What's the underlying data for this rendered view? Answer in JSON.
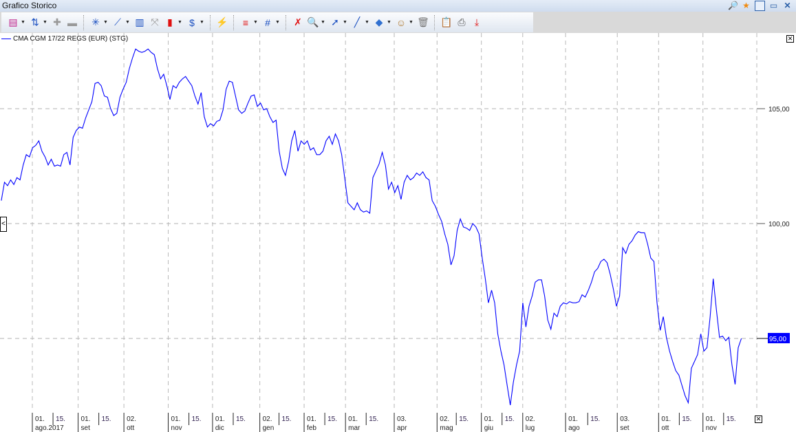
{
  "window": {
    "title": "Grafico Storico"
  },
  "toolbar": {
    "buttons": [
      {
        "icon": "chart-type-icon",
        "dropdown": true,
        "glyph": "▤",
        "color": "#c0208a"
      },
      {
        "icon": "indicators-icon",
        "dropdown": true,
        "glyph": "⇅",
        "color": "#1a4fc0"
      },
      {
        "icon": "add-series-icon",
        "dropdown": false,
        "glyph": "✚",
        "color": "#999999"
      },
      {
        "icon": "remove-series-icon",
        "dropdown": false,
        "glyph": "▬",
        "color": "#999999"
      },
      {
        "sep": true
      },
      {
        "icon": "new-study-icon",
        "dropdown": true,
        "glyph": "✳",
        "color": "#1a4fc0"
      },
      {
        "icon": "trend-icon",
        "dropdown": true,
        "glyph": "⟋",
        "color": "#1a4fc0"
      },
      {
        "icon": "volume-bars-icon",
        "dropdown": false,
        "glyph": "▥",
        "color": "#1a4fc0"
      },
      {
        "icon": "compare-icon",
        "dropdown": false,
        "glyph": "⤧",
        "color": "#999999"
      },
      {
        "icon": "candlestick-icon",
        "dropdown": true,
        "glyph": "▮",
        "color": "#e01010"
      },
      {
        "icon": "currency-icon",
        "dropdown": true,
        "glyph": "$",
        "color": "#1a4fc0"
      },
      {
        "sep": true
      },
      {
        "icon": "refresh-chart-icon",
        "dropdown": false,
        "glyph": "⚡",
        "color": "#1a4fc0"
      },
      {
        "sep": true
      },
      {
        "icon": "line-style-icon",
        "dropdown": true,
        "glyph": "≡",
        "color": "#e01010"
      },
      {
        "icon": "grid-icon",
        "dropdown": true,
        "glyph": "#",
        "color": "#1a4fc0"
      },
      {
        "sep": true
      },
      {
        "icon": "delete-drawings-icon",
        "dropdown": false,
        "glyph": "✗",
        "color": "#e01010"
      },
      {
        "icon": "zoom-icon",
        "dropdown": true,
        "glyph": "🔍",
        "color": "#1a4fc0"
      },
      {
        "icon": "pointer-icon",
        "dropdown": true,
        "glyph": "➚",
        "color": "#1a4fc0"
      },
      {
        "icon": "draw-line-icon",
        "dropdown": true,
        "glyph": "╱",
        "color": "#1a4fc0"
      },
      {
        "icon": "fill-color-icon",
        "dropdown": true,
        "glyph": "◆",
        "color": "#3070d0"
      },
      {
        "icon": "template-icon",
        "dropdown": true,
        "glyph": "☺",
        "color": "#b07a30"
      },
      {
        "icon": "trash-icon",
        "dropdown": false,
        "glyph": "🗑",
        "color": "#777777"
      },
      {
        "sep": true
      },
      {
        "icon": "clipboard-icon",
        "dropdown": false,
        "glyph": "📋",
        "color": "#e01010"
      },
      {
        "icon": "print-icon",
        "dropdown": false,
        "glyph": "⎙",
        "color": "#555555"
      },
      {
        "icon": "export-icon",
        "dropdown": false,
        "glyph": "⤓",
        "color": "#e01010"
      }
    ]
  },
  "window_icons": [
    "search-folder-icon",
    "favorite-star-icon",
    "maximize-icon",
    "restore-icon",
    "close-icon"
  ],
  "legend": {
    "label": "CMA CGM 17/22 REGS (EUR) (STG)",
    "color": "#0000ff"
  },
  "chart_data": {
    "type": "line",
    "title": "CMA CGM 17/22 REGS (EUR) (STG)",
    "xlabel": "",
    "ylabel": "",
    "ylim": [
      91.9,
      108.4
    ],
    "y_ticks": [
      {
        "value": 105,
        "label": "105,00"
      },
      {
        "value": 100,
        "label": "100,00"
      }
    ],
    "last_value_label": {
      "value": 95,
      "label": "95,00",
      "bg": "#0000ff"
    },
    "x_origin_date": "2017-08-01",
    "x_range_days": [
      -21,
      480
    ],
    "x_ticks": [
      {
        "day": 0,
        "day_label": "01.",
        "month_label": "ago.2017",
        "major": true
      },
      {
        "day": 14,
        "day_label": "15.",
        "month_label": "",
        "major": false
      },
      {
        "day": 31,
        "day_label": "01.",
        "month_label": "set",
        "major": true
      },
      {
        "day": 45,
        "day_label": "15.",
        "month_label": "",
        "major": false
      },
      {
        "day": 62,
        "day_label": "02.",
        "month_label": "ott",
        "major": true
      },
      {
        "day": 92,
        "day_label": "01.",
        "month_label": "nov",
        "major": true
      },
      {
        "day": 106,
        "day_label": "15.",
        "month_label": "",
        "major": false
      },
      {
        "day": 122,
        "day_label": "01.",
        "month_label": "dic",
        "major": true
      },
      {
        "day": 136,
        "day_label": "15.",
        "month_label": "",
        "major": false
      },
      {
        "day": 154,
        "day_label": "02.",
        "month_label": "gen",
        "major": true
      },
      {
        "day": 167,
        "day_label": "15.",
        "month_label": "",
        "major": false
      },
      {
        "day": 184,
        "day_label": "01.",
        "month_label": "feb",
        "major": true
      },
      {
        "day": 198,
        "day_label": "15.",
        "month_label": "",
        "major": false
      },
      {
        "day": 212,
        "day_label": "01.",
        "month_label": "mar",
        "major": true
      },
      {
        "day": 226,
        "day_label": "15.",
        "month_label": "",
        "major": false
      },
      {
        "day": 245,
        "day_label": "03.",
        "month_label": "apr",
        "major": true
      },
      {
        "day": 274,
        "day_label": "02.",
        "month_label": "mag",
        "major": true
      },
      {
        "day": 287,
        "day_label": "15.",
        "month_label": "",
        "major": false
      },
      {
        "day": 304,
        "day_label": "01.",
        "month_label": "giu",
        "major": true
      },
      {
        "day": 318,
        "day_label": "15.",
        "month_label": "",
        "major": false
      },
      {
        "day": 332,
        "day_label": "02.",
        "month_label": "lug",
        "major": true
      },
      {
        "day": 361,
        "day_label": "01.",
        "month_label": "ago",
        "major": true
      },
      {
        "day": 376,
        "day_label": "15.",
        "month_label": "",
        "major": false
      },
      {
        "day": 396,
        "day_label": "03.",
        "month_label": "set",
        "major": true
      },
      {
        "day": 424,
        "day_label": "01.",
        "month_label": "ott",
        "major": true
      },
      {
        "day": 438,
        "day_label": "15.",
        "month_label": "",
        "major": false
      },
      {
        "day": 454,
        "day_label": "01.",
        "month_label": "nov",
        "major": true
      },
      {
        "day": 468,
        "day_label": "15.",
        "month_label": "",
        "major": false
      }
    ],
    "series": [
      {
        "name": "CMA CGM 17/22 REGS (EUR) (STG)",
        "color": "#0000ff",
        "values": [
          101.0,
          101.8,
          101.65,
          101.9,
          101.7,
          102.0,
          101.9,
          102.55,
          103.0,
          102.9,
          103.3,
          103.4,
          103.6,
          103.15,
          102.9,
          102.55,
          102.8,
          102.5,
          102.55,
          102.5,
          103.0,
          103.1,
          102.55,
          103.75,
          104.05,
          104.2,
          104.15,
          104.6,
          104.95,
          105.3,
          106.1,
          106.15,
          106.0,
          105.55,
          105.5,
          105.0,
          104.7,
          104.8,
          105.5,
          105.85,
          106.15,
          106.75,
          107.2,
          107.6,
          107.5,
          107.45,
          107.5,
          107.6,
          107.45,
          107.35,
          106.75,
          106.3,
          106.5,
          106.0,
          105.4,
          106.0,
          105.9,
          106.15,
          106.3,
          106.4,
          106.2,
          106.0,
          105.55,
          105.2,
          105.7,
          104.65,
          104.2,
          104.35,
          104.25,
          104.45,
          104.5,
          104.95,
          105.85,
          106.2,
          106.15,
          105.55,
          104.95,
          104.8,
          104.9,
          105.25,
          105.55,
          105.6,
          105.1,
          105.25,
          104.95,
          105.0,
          104.65,
          104.4,
          104.5,
          103.15,
          102.4,
          102.1,
          102.7,
          103.6,
          104.05,
          103.15,
          103.6,
          103.45,
          103.6,
          103.2,
          103.3,
          103.0,
          103.0,
          103.15,
          103.6,
          103.8,
          103.45,
          103.9,
          103.6,
          103.0,
          101.95,
          100.9,
          100.75,
          100.6,
          100.9,
          100.6,
          100.5,
          100.55,
          100.45,
          102.0,
          102.3,
          102.6,
          103.1,
          102.55,
          101.5,
          101.8,
          101.35,
          101.65,
          101.05,
          101.8,
          102.1,
          101.9,
          102.0,
          102.2,
          102.1,
          102.25,
          102.0,
          101.9,
          101.0,
          100.75,
          100.4,
          100.1,
          99.55,
          99.1,
          98.2,
          98.6,
          99.7,
          100.2,
          99.85,
          99.8,
          99.7,
          100.0,
          99.85,
          99.55,
          98.5,
          97.6,
          96.55,
          97.1,
          96.55,
          95.2,
          94.45,
          93.85,
          92.95,
          92.1,
          93.1,
          93.85,
          94.45,
          96.55,
          95.5,
          96.4,
          96.85,
          97.45,
          97.55,
          97.55,
          96.85,
          95.8,
          95.4,
          96.1,
          95.95,
          96.4,
          96.55,
          96.5,
          96.6,
          96.55,
          96.55,
          96.6,
          96.9,
          96.8,
          97.1,
          97.45,
          97.9,
          98.05,
          98.35,
          98.45,
          98.3,
          97.8,
          97.15,
          96.4,
          96.85,
          98.95,
          98.7,
          99.1,
          99.25,
          99.5,
          99.65,
          99.6,
          99.6,
          99.1,
          98.5,
          98.35,
          96.55,
          95.35,
          95.95,
          95.05,
          94.45,
          94.0,
          93.6,
          93.4,
          92.95,
          92.5,
          92.2,
          93.7,
          94.0,
          94.3,
          95.2,
          94.45,
          94.6,
          95.95,
          97.6,
          96.25,
          95.05,
          95.1,
          94.9,
          95.05,
          93.85,
          93.0,
          94.6,
          95.0
        ]
      }
    ],
    "grid": true,
    "legend_position": "top-left"
  }
}
